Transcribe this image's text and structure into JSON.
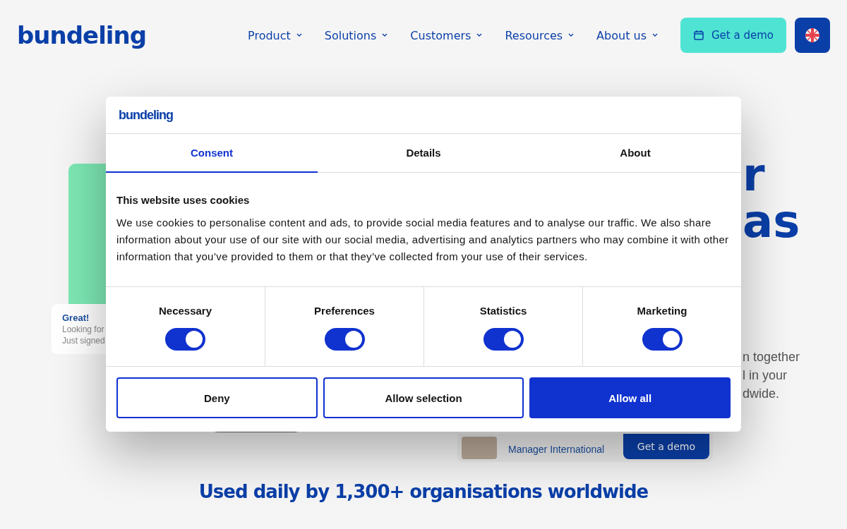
{
  "header": {
    "logo": "bundeling",
    "nav": [
      {
        "label": "Product"
      },
      {
        "label": "Solutions"
      },
      {
        "label": "Customers"
      },
      {
        "label": "Resources"
      },
      {
        "label": "About us"
      }
    ],
    "demo_button": "Get a demo"
  },
  "hero": {
    "heading_fragments": [
      "r",
      "as"
    ],
    "text_fragments": [
      "n together",
      "l in your",
      "dwide."
    ],
    "notification": {
      "title": "Great!",
      "lines": [
        "Looking for",
        "Just signed"
      ]
    },
    "person_card": {
      "role": "Manager International",
      "button": "Get a demo"
    }
  },
  "section_title": "Used daily by 1,300+ organisations worldwide",
  "cookie_dialog": {
    "logo": "bundeling",
    "tabs": [
      {
        "label": "Consent",
        "selected": true
      },
      {
        "label": "Details",
        "selected": false
      },
      {
        "label": "About",
        "selected": false
      }
    ],
    "title": "This website uses cookies",
    "text": "We use cookies to personalise content and ads, to provide social media features and to analyse our traffic. We also share information about your use of our site with our social media, advertising and analytics partners who may combine it with other information that you’ve provided to them or that they’ve collected from your use of their services.",
    "categories": [
      {
        "label": "Necessary",
        "on": true
      },
      {
        "label": "Preferences",
        "on": true
      },
      {
        "label": "Statistics",
        "on": true
      },
      {
        "label": "Marketing",
        "on": true
      }
    ],
    "buttons": [
      {
        "label": "Deny",
        "kind": "outline"
      },
      {
        "label": "Allow selection",
        "kind": "outline"
      },
      {
        "label": "Allow all",
        "kind": "filled"
      }
    ]
  }
}
